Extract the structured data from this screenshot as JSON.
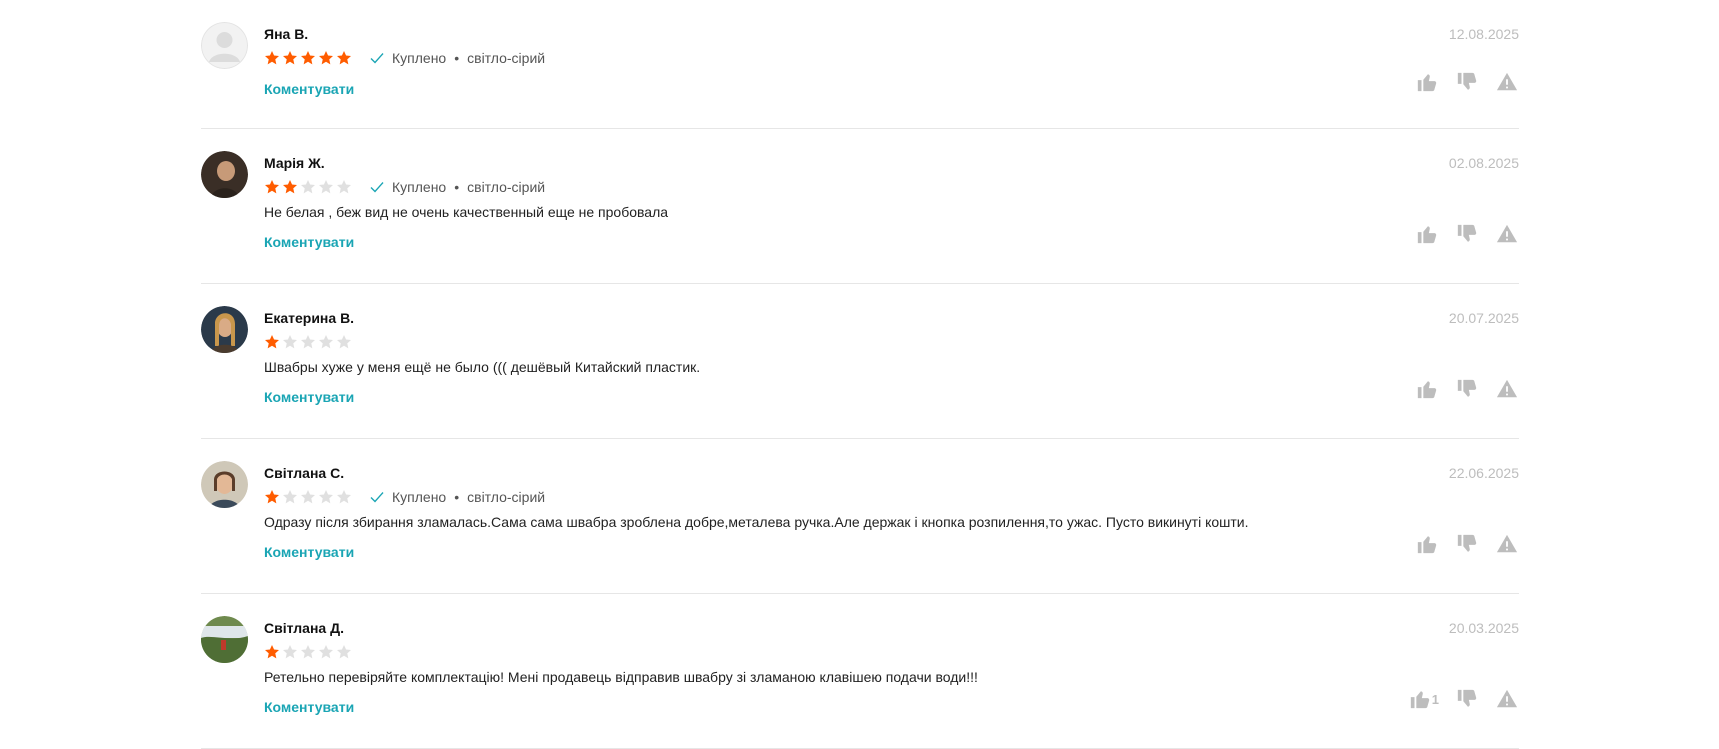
{
  "labels": {
    "comment": "Коментувати",
    "bought": "Куплено"
  },
  "colors": {
    "star_on": "#ff5c00",
    "star_off": "#e0e0e0",
    "accent": "#1aa5b4",
    "muted": "#bdbdbd"
  },
  "reviews": [
    {
      "author": "Яна В.",
      "rating": 5,
      "bought": true,
      "variant": "світло-сірий",
      "text": "",
      "date": "12.08.2025",
      "likes": ""
    },
    {
      "author": "Марія Ж.",
      "rating": 2,
      "bought": true,
      "variant": "світло-сірий",
      "text": "Не белая , беж вид не очень качественный еще не пробовала",
      "date": "02.08.2025",
      "likes": ""
    },
    {
      "author": "Екатерина В.",
      "rating": 1,
      "bought": false,
      "variant": "",
      "text": "Швабры хуже у меня ещё не было ((( дешёвый Китайский пластик.",
      "date": "20.07.2025",
      "likes": ""
    },
    {
      "author": "Світлана С.",
      "rating": 1,
      "bought": true,
      "variant": "світло-сірий",
      "text": "Одразу після збирання зламалась.Сама сама швабра зроблена добре,металева ручка.Але держак і кнопка розпилення,то ужас. Пусто викинуті кошти.",
      "date": "22.06.2025",
      "likes": ""
    },
    {
      "author": "Світлана Д.",
      "rating": 1,
      "bought": false,
      "variant": "",
      "text": "Ретельно перевіряйте комплектацію! Мені продавець відправив швабру зі зламаною клавішею подачи води!!!",
      "date": "20.03.2025",
      "likes": "1"
    }
  ]
}
